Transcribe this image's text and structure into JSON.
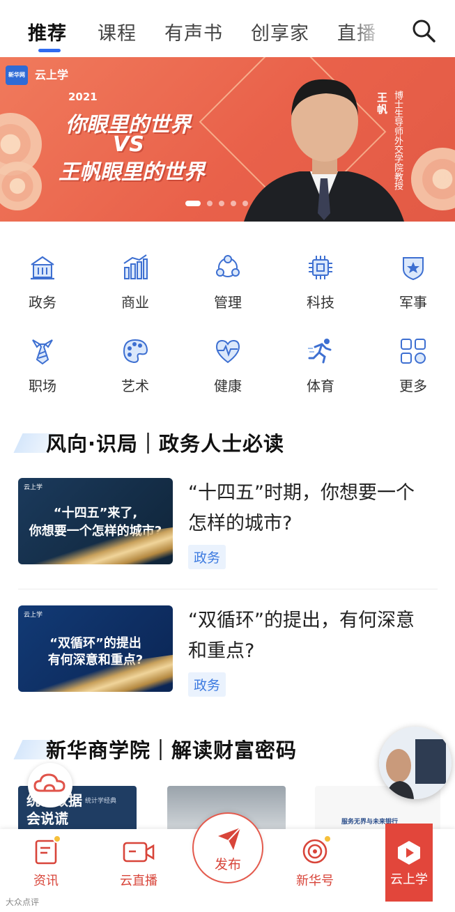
{
  "top_tabs": [
    "推荐",
    "课程",
    "有声书",
    "创享家",
    "直播"
  ],
  "banner": {
    "logo_left": "新华网",
    "logo_right": "云上学",
    "year": "2021",
    "line1": "你眼里的世界",
    "line2": "VS",
    "line3": "王帆眼里的世界",
    "speaker_name": "王帆",
    "speaker_title": "博士生导师外交学院教授",
    "slide_count": 5,
    "active_slide": 1
  },
  "categories": [
    {
      "label": "政务",
      "icon": "government-building-icon"
    },
    {
      "label": "商业",
      "icon": "bar-chart-icon"
    },
    {
      "label": "管理",
      "icon": "team-network-icon"
    },
    {
      "label": "科技",
      "icon": "chip-icon"
    },
    {
      "label": "军事",
      "icon": "star-shield-icon"
    },
    {
      "label": "职场",
      "icon": "necktie-icon"
    },
    {
      "label": "艺术",
      "icon": "palette-icon"
    },
    {
      "label": "健康",
      "icon": "heartbeat-icon"
    },
    {
      "label": "体育",
      "icon": "runner-icon"
    },
    {
      "label": "更多",
      "icon": "grid-more-icon"
    }
  ],
  "section1": {
    "title": "风向·识局｜政务人士必读",
    "articles": [
      {
        "title": "“十四五”时期，你想要一个怎样的城市?",
        "tag": "政务",
        "thumb_line1": "“十四五”来了,",
        "thumb_line2": "你想要一个怎样的城市?",
        "thumb_logo": "云上学"
      },
      {
        "title": "“双循环”的提出，有何深意和重点?",
        "tag": "政务",
        "thumb_line1": "“双循环”的提出",
        "thumb_line2": "有何深意和重点?",
        "thumb_logo": "云上学"
      }
    ]
  },
  "section2": {
    "title": "新华商学院｜解读财富密码",
    "peek_1_text": "统计数据会说谎",
    "peek_1_sub": "统计学经典",
    "peek_3_text": "服务无界与未来银行"
  },
  "bottom_nav": {
    "news": "资讯",
    "live": "云直播",
    "publish": "发布",
    "xinhua": "新华号",
    "yunshangxue": "云上学"
  },
  "watermark": "大众点评",
  "colors": {
    "accent_blue": "#2f6bf0",
    "nav_red": "#d8453a",
    "banner_orange": "#e9614a",
    "tag_bg": "#eaf2fd"
  }
}
